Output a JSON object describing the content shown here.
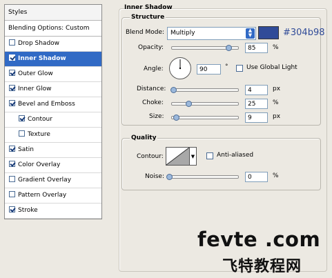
{
  "styles": {
    "header": "Styles",
    "blending_options": "Blending Options: Custom",
    "items": [
      {
        "label": "Drop Shadow",
        "checked": false
      },
      {
        "label": "Inner Shadow",
        "checked": true,
        "selected": true
      },
      {
        "label": "Outer Glow",
        "checked": true
      },
      {
        "label": "Inner Glow",
        "checked": true
      },
      {
        "label": "Bevel and Emboss",
        "checked": true
      },
      {
        "label": "Contour",
        "checked": true,
        "indent": true
      },
      {
        "label": "Texture",
        "checked": false,
        "indent": true
      },
      {
        "label": "Satin",
        "checked": true
      },
      {
        "label": "Color Overlay",
        "checked": true
      },
      {
        "label": "Gradient Overlay",
        "checked": false
      },
      {
        "label": "Pattern Overlay",
        "checked": false
      },
      {
        "label": "Stroke",
        "checked": true
      }
    ]
  },
  "panel": {
    "title": "Inner Shadow",
    "structure": {
      "title": "Structure",
      "blend_mode_label": "Blend Mode:",
      "blend_mode_value": "Multiply",
      "color": "#304b98",
      "color_label": "#304b98",
      "opacity_label": "Opacity:",
      "opacity_value": "85",
      "opacity_unit": "%",
      "opacity_fraction": 0.85,
      "angle_label": "Angle:",
      "angle_value": "90",
      "angle_unit": "°",
      "angle_degrees": 90,
      "use_global_light_label": "Use Global Light",
      "use_global_light": false,
      "distance_label": "Distance:",
      "distance_value": "4",
      "distance_unit": "px",
      "distance_fraction": 0.02,
      "choke_label": "Choke:",
      "choke_value": "25",
      "choke_unit": "%",
      "choke_fraction": 0.25,
      "size_label": "Size:",
      "size_value": "9",
      "size_unit": "px",
      "size_fraction": 0.06
    },
    "quality": {
      "title": "Quality",
      "contour_label": "Contour:",
      "anti_aliased_label": "Anti-aliased",
      "anti_aliased": false,
      "noise_label": "Noise:",
      "noise_value": "0",
      "noise_unit": "%",
      "noise_fraction": 0
    }
  },
  "watermark": {
    "line1": "fevte .com",
    "line2": "飞特教程网"
  }
}
